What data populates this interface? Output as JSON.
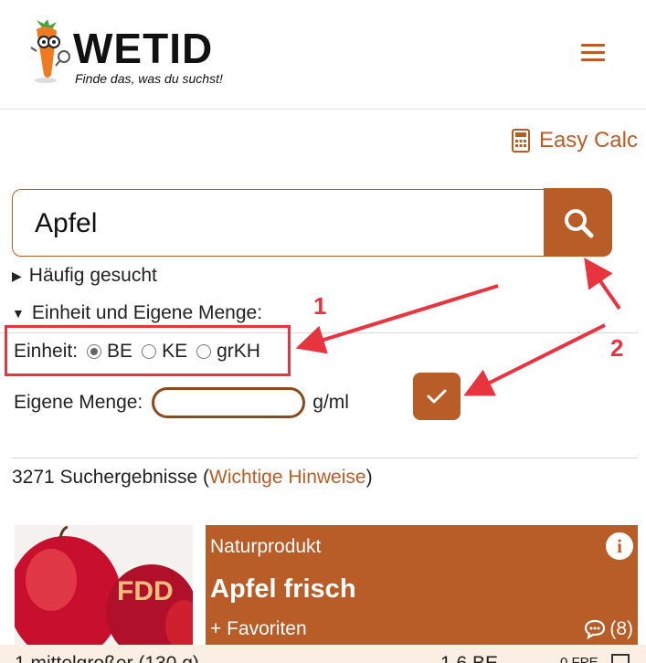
{
  "header": {
    "logo_title": "WETID",
    "logo_subtitle": "Finde das, was du suchst!",
    "menu_icon": "hamburger-icon"
  },
  "easy_calc": {
    "label": "Easy Calc",
    "icon": "calculator-icon"
  },
  "search": {
    "value": "Apfel",
    "placeholder": "",
    "button_icon": "search-icon"
  },
  "frequent": {
    "label": "Häufig gesucht"
  },
  "unit_section": {
    "summary": "Einheit und Eigene Menge:",
    "unit_label": "Einheit:",
    "options": [
      "BE",
      "KE",
      "grKH"
    ],
    "selected": "BE",
    "amount_label": "Eigene Menge:",
    "amount_value": "",
    "amount_unit": "g/ml",
    "confirm_icon": "checkmark-icon"
  },
  "results": {
    "count_text": "3271 Suchergebnisse",
    "link_text": "Wichtige Hinweise",
    "open": "(",
    "close": ")"
  },
  "card": {
    "type": "Naturprodukt",
    "title": "Apfel frisch",
    "favorites": "+ Favoriten",
    "comments": "(8)",
    "image_text": "FDD",
    "portion_label": "1 mittelgroßer (130 g)",
    "portion_value": "1,6 BE",
    "portion_extra": "0 FPE"
  },
  "annotations": {
    "one": "1",
    "two": "2",
    "color": "#e8343f"
  },
  "colors": {
    "accent": "#b85c28"
  }
}
